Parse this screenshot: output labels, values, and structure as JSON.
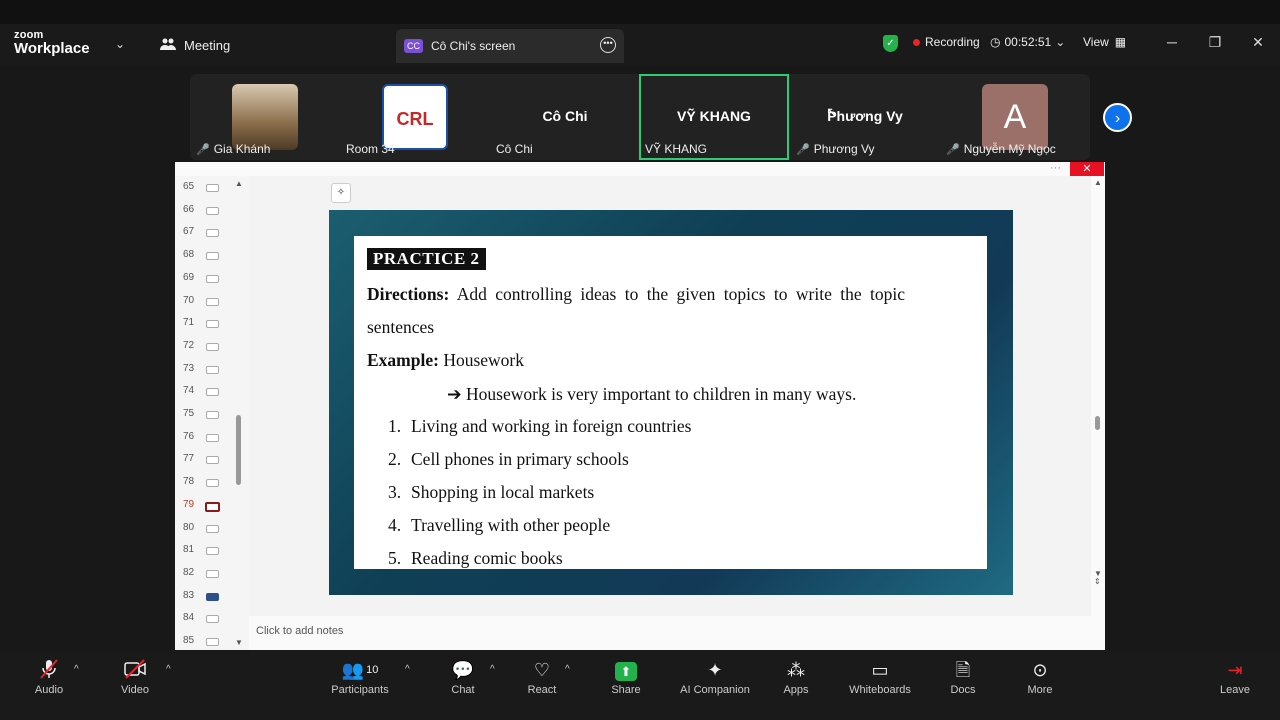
{
  "app": {
    "logo_top": "zoom",
    "logo_bottom": "Workplace",
    "meeting_label": "Meeting",
    "share_tab_badge": "CC",
    "share_tab_label": "Cô Chi's screen",
    "recording_label": "Recording",
    "timer": "00:52:51",
    "view_label": "View"
  },
  "participants": [
    {
      "name": "Gia Khánh",
      "muted": true,
      "kind": "photo"
    },
    {
      "name": "Room 34",
      "muted": false,
      "kind": "logo",
      "logo_text": "CRL"
    },
    {
      "name": "Cô Chi",
      "muted": false,
      "kind": "text",
      "display": "Cô Chi"
    },
    {
      "name": "VỸ KHANG",
      "muted": false,
      "kind": "text",
      "display": "VỸ KHANG",
      "active": true
    },
    {
      "name": "Phương Vy",
      "muted": true,
      "kind": "text",
      "display": "Phương Vy"
    },
    {
      "name": "Nguyễn Mỹ Ngọc",
      "muted": true,
      "kind": "avatar",
      "initial": "A"
    }
  ],
  "slides_panel": {
    "numbers": [
      "65",
      "66",
      "67",
      "68",
      "69",
      "70",
      "71",
      "72",
      "73",
      "74",
      "75",
      "76",
      "77",
      "78",
      "79",
      "80",
      "81",
      "82",
      "83",
      "84",
      "85"
    ],
    "current": "79"
  },
  "slide": {
    "heading": "PRACTICE 2",
    "directions_label": "Directions:",
    "directions_text": " Add controlling ideas to the given topics to write the topic",
    "directions_text2": "sentences",
    "example_label": "Example:",
    "example_text": " Housework",
    "example_answer": "Housework is very important to children in many ways.",
    "items": [
      {
        "num": "1.",
        "text": "Living and working in foreign countries"
      },
      {
        "num": "2.",
        "text": "Cell phones in primary schools"
      },
      {
        "num": "3.",
        "text": "Shopping in local markets"
      },
      {
        "num": "4.",
        "text": "Travelling with other people"
      },
      {
        "num": "5.",
        "text": "Reading comic books"
      }
    ]
  },
  "notes_placeholder": "Click to add notes",
  "toolbar": {
    "audio": "Audio",
    "video": "Video",
    "participants": "Participants",
    "participants_count": "10",
    "chat": "Chat",
    "react": "React",
    "share": "Share",
    "ai": "AI Companion",
    "apps": "Apps",
    "whiteboards": "Whiteboards",
    "docs": "Docs",
    "more": "More",
    "leave": "Leave"
  },
  "colors": {
    "share_green": "#22b14c",
    "active_border": "#2ecc71",
    "accent_blue": "#0e72ed",
    "mute_red": "#e5242b"
  }
}
